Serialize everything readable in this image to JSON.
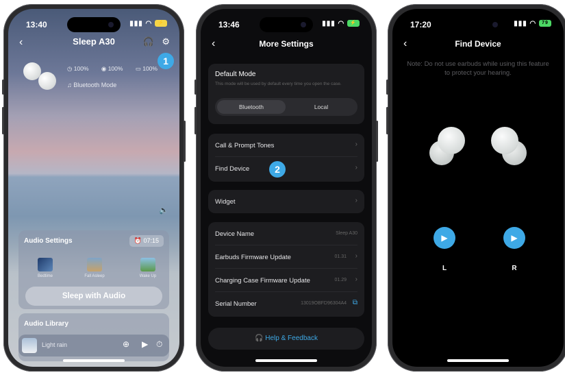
{
  "phone1": {
    "status_time": "13:40",
    "title": "Sleep A30",
    "badge": "1",
    "batteries": [
      "100%",
      "100%",
      "100%"
    ],
    "mode": "Bluetooth Mode",
    "audio_settings": {
      "title": "Audio Settings",
      "timer": "07:15",
      "items": [
        "Bedtime",
        "Fall Asleep",
        "Wake Up"
      ]
    },
    "sleep_button": "Sleep with Audio",
    "library_title": "Audio Library",
    "now_playing": "Light rain"
  },
  "phone2": {
    "status_time": "13:46",
    "title": "More Settings",
    "badge": "2",
    "default_mode": {
      "title": "Default Mode",
      "desc": "This mode will be used by default every time you open the case.",
      "options": [
        "Bluetooth",
        "Local"
      ],
      "selected": "Bluetooth"
    },
    "group1": [
      "Call & Prompt Tones",
      "Find Device"
    ],
    "group2": [
      "Widget"
    ],
    "group3": [
      {
        "label": "Device Name",
        "value": "Sleep A30"
      },
      {
        "label": "Earbuds Firmware Update",
        "value": "01.31"
      },
      {
        "label": "Charging Case Firmware Update",
        "value": "01.29"
      },
      {
        "label": "Serial Number",
        "value": "13019OBFD96304A4"
      }
    ],
    "help": "Help & Feedback"
  },
  "phone3": {
    "status_time": "17:20",
    "battery": "79",
    "title": "Find Device",
    "note": "Note: Do not use earbuds while using this feature to protect your hearing.",
    "left": "L",
    "right": "R"
  },
  "colors": {
    "accent": "#3ea9e6",
    "dark_bg": "#0c0c0e",
    "card": "#1d1d20"
  },
  "icons": [
    "back-chevron",
    "headphones",
    "gear",
    "music-note",
    "speaker",
    "clock",
    "play",
    "timer",
    "download",
    "chevron-right",
    "copy",
    "help-headset"
  ]
}
